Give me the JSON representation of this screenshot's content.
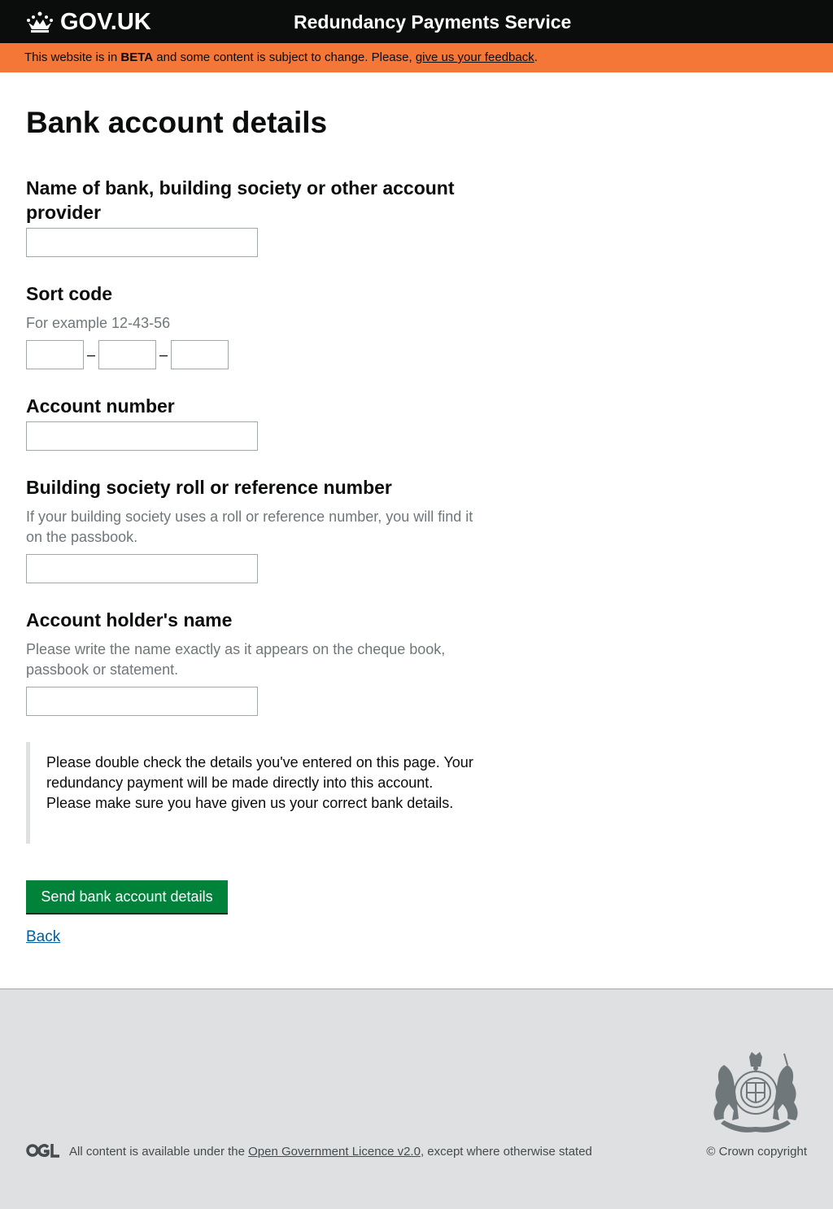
{
  "header": {
    "logo_text": "GOV.UK",
    "service_name": "Redundancy Payments Service"
  },
  "beta_banner": {
    "prefix": "This website is in ",
    "tag": "BETA",
    "middle": " and some content is subject to change. Please, ",
    "link": "give us your feedback",
    "suffix": "."
  },
  "page": {
    "title": "Bank account details"
  },
  "form": {
    "bank_name": {
      "label": "Name of bank, building society or other account provider",
      "value": ""
    },
    "sort_code": {
      "label": "Sort code",
      "hint": "For example 12-43-56",
      "separator": "–",
      "parts": [
        "",
        "",
        ""
      ]
    },
    "account_number": {
      "label": "Account number",
      "value": ""
    },
    "roll_number": {
      "label": "Building society roll or reference number",
      "hint": "If your building society uses a roll or reference number, you will find it on the passbook.",
      "value": ""
    },
    "holder_name": {
      "label": "Account holder's name",
      "hint": "Please write the name exactly as it appears on the cheque book, passbook or statement.",
      "value": ""
    },
    "notice": "Please double check the details you've entered on this page. Your redundancy payment will be made directly into this account. Please make sure you have given us your correct bank details.",
    "submit_label": "Send bank account details",
    "back_label": "Back"
  },
  "footer": {
    "ogl_text": "OGL",
    "licence_prefix": "All content is available under the ",
    "licence_link": "Open Government Licence v2.0",
    "licence_suffix": ", except where otherwise stated",
    "copyright": "© Crown copyright",
    "crest_text_top": "HONI SOIT QUI MAL Y PENSE",
    "crest_text_bottom": "DIEU ET MON DROIT"
  },
  "colors": {
    "header_bg": "#0b0c0c",
    "beta_bg": "#f47738",
    "button_green": "#00823b",
    "link_blue": "#005ea5",
    "footer_bg": "#dee0e2",
    "hint_grey": "#6f777b"
  }
}
